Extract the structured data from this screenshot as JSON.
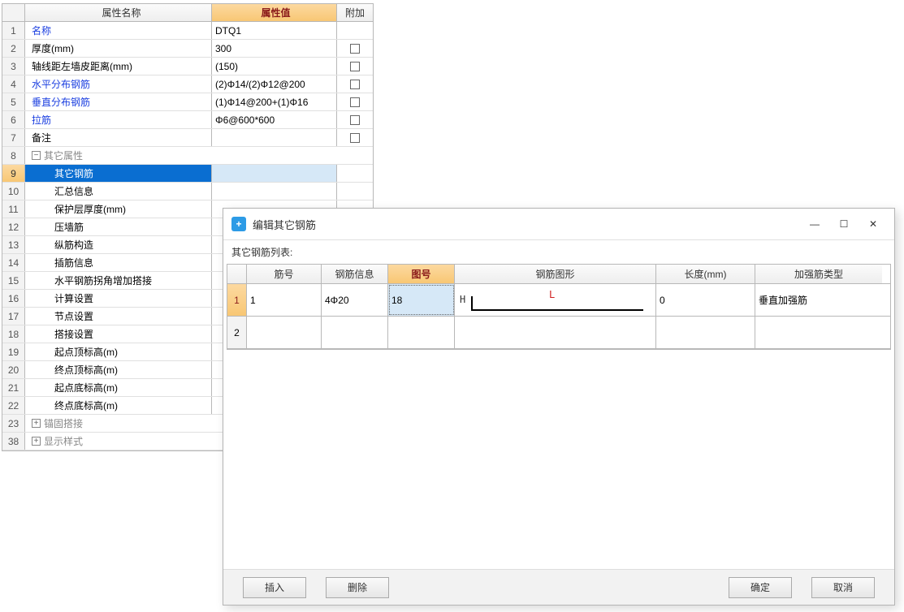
{
  "propGrid": {
    "headers": {
      "name": "属性名称",
      "value": "属性值",
      "extra": "附加"
    },
    "rows": [
      {
        "n": "1",
        "name": "名称",
        "val": "DTQ1",
        "chk": false,
        "link": true
      },
      {
        "n": "2",
        "name": "厚度(mm)",
        "val": "300",
        "chk": true
      },
      {
        "n": "3",
        "name": "轴线距左墙皮距离(mm)",
        "val": "(150)",
        "chk": true
      },
      {
        "n": "4",
        "name": "水平分布钢筋",
        "val": "(2)Φ14/(2)Φ12@200",
        "chk": true,
        "link": true
      },
      {
        "n": "5",
        "name": "垂直分布钢筋",
        "val": "(1)Φ14@200+(1)Φ16",
        "chk": true,
        "link": true
      },
      {
        "n": "6",
        "name": "拉筋",
        "val": "Φ6@600*600",
        "chk": true,
        "link": true
      },
      {
        "n": "7",
        "name": "备注",
        "val": "",
        "chk": true
      },
      {
        "n": "8",
        "name": "其它属性",
        "group": "minus",
        "grey": true,
        "noval": true
      },
      {
        "n": "9",
        "name": "其它钢筋",
        "indent": 1,
        "selected": true
      },
      {
        "n": "10",
        "name": "汇总信息",
        "indent": 1
      },
      {
        "n": "11",
        "name": "保护层厚度(mm)",
        "indent": 1
      },
      {
        "n": "12",
        "name": "压墙筋",
        "indent": 1
      },
      {
        "n": "13",
        "name": "纵筋构造",
        "indent": 1
      },
      {
        "n": "14",
        "name": "插筋信息",
        "indent": 1
      },
      {
        "n": "15",
        "name": "水平钢筋拐角增加搭接",
        "indent": 1
      },
      {
        "n": "16",
        "name": "计算设置",
        "indent": 1
      },
      {
        "n": "17",
        "name": "节点设置",
        "indent": 1
      },
      {
        "n": "18",
        "name": "搭接设置",
        "indent": 1
      },
      {
        "n": "19",
        "name": "起点顶标高(m)",
        "indent": 1
      },
      {
        "n": "20",
        "name": "终点顶标高(m)",
        "indent": 1
      },
      {
        "n": "21",
        "name": "起点底标高(m)",
        "indent": 1
      },
      {
        "n": "22",
        "name": "终点底标高(m)",
        "indent": 1
      },
      {
        "n": "23",
        "name": "锚固搭接",
        "group": "plus",
        "grey": true,
        "noval": true
      },
      {
        "n": "38",
        "name": "显示样式",
        "group": "plus",
        "grey": true,
        "noval": true
      }
    ]
  },
  "dialog": {
    "title": "编辑其它钢筋",
    "subtitle": "其它钢筋列表:",
    "headers": {
      "a": "筋号",
      "b": "钢筋信息",
      "c": "图号",
      "d": "钢筋图形",
      "e": "长度(mm)",
      "f": "加强筋类型"
    },
    "rows": [
      {
        "n": "1",
        "a": "1",
        "b": "4Φ20",
        "c": "18",
        "shape": "L",
        "H": "H",
        "L": "L",
        "e": "0",
        "f": "垂直加强筋"
      },
      {
        "n": "2",
        "a": "",
        "b": "",
        "c": "",
        "e": "",
        "f": ""
      }
    ],
    "buttons": {
      "insert": "插入",
      "remove": "删除",
      "ok": "确定",
      "cancel": "取消"
    }
  }
}
